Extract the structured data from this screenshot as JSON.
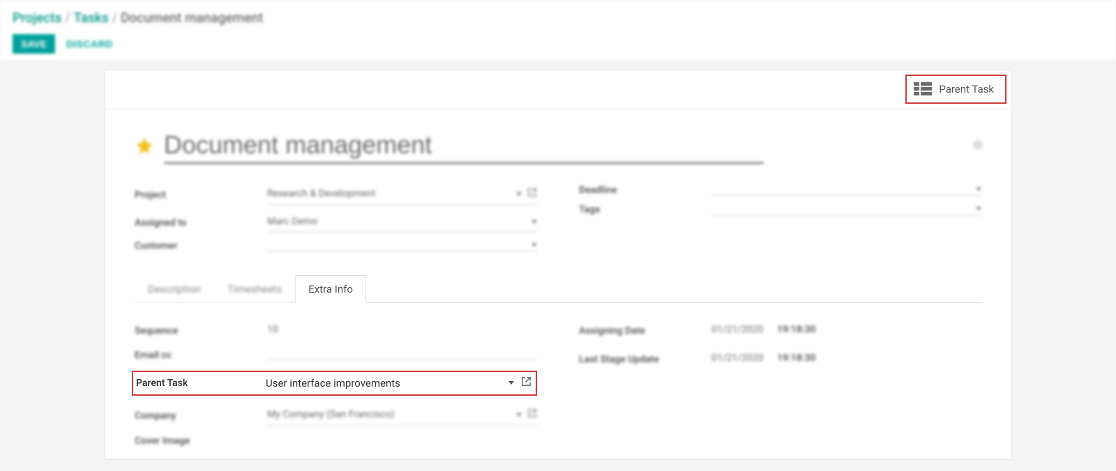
{
  "breadcrumb": {
    "l1": "Projects",
    "l2": "Tasks",
    "current": "Document management"
  },
  "actions": {
    "save": "SAVE",
    "discard": "DISCARD"
  },
  "stat": {
    "label": "Parent Task"
  },
  "title": "Document management",
  "left_fields": {
    "project": {
      "label": "Project",
      "value": "Research & Development"
    },
    "assigned": {
      "label": "Assigned to",
      "value": "Marc Demo"
    },
    "customer": {
      "label": "Customer",
      "value": ""
    }
  },
  "right_fields": {
    "deadline": {
      "label": "Deadline",
      "value": ""
    },
    "tags": {
      "label": "Tags",
      "value": ""
    }
  },
  "tabs": [
    {
      "label": "Description",
      "active": false
    },
    {
      "label": "Timesheets",
      "active": false
    },
    {
      "label": "Extra Info",
      "active": true
    }
  ],
  "extra_left": {
    "sequence": {
      "label": "Sequence",
      "value": "10"
    },
    "emailcc": {
      "label": "Email cc",
      "value": ""
    },
    "parent": {
      "label": "Parent Task",
      "value": "User interface improvements"
    },
    "company": {
      "label": "Company",
      "value": "My Company (San Francisco)"
    },
    "cover": {
      "label": "Cover Image",
      "value": ""
    }
  },
  "extra_right": {
    "assigning_date": {
      "label": "Assigning Date",
      "date": "01/21/2020",
      "time": "19:18:30"
    },
    "last_stage": {
      "label": "Last Stage Update",
      "date": "01/21/2020",
      "time": "19:18:30"
    }
  }
}
